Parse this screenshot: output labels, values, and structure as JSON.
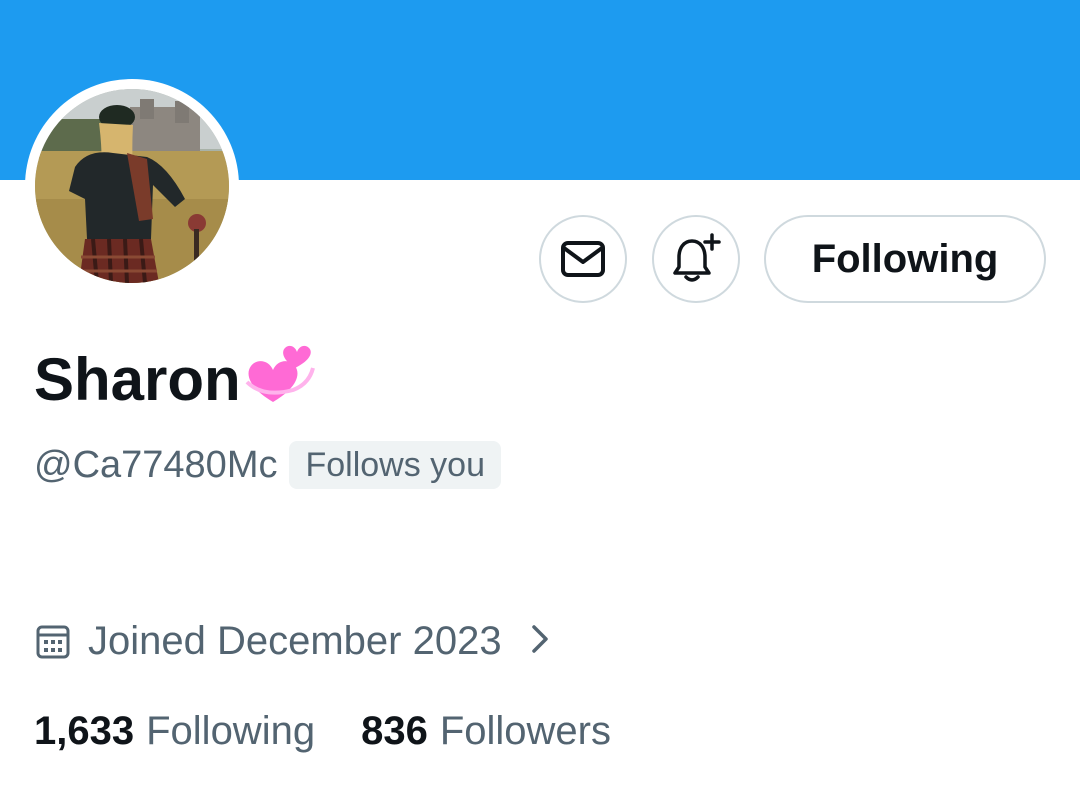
{
  "colors": {
    "banner": "#1d9bf0",
    "text_primary": "#0f1419",
    "text_secondary": "#536471",
    "border": "#cfd9de",
    "badge_bg": "#eff3f4"
  },
  "header": {
    "banner_color": "#1d9bf0"
  },
  "profile": {
    "display_name": "Sharon",
    "name_emoji": "two-hearts-icon",
    "handle": "@Ca77480Mc",
    "follows_you_badge": "Follows you",
    "avatar": "avatar-photo"
  },
  "actions": {
    "message_icon": "envelope-icon",
    "notify_icon": "bell-plus-icon",
    "follow_button_label": "Following"
  },
  "meta": {
    "joined_icon": "calendar-icon",
    "joined_text": "Joined December 2023",
    "joined_chevron": "chevron-right-icon"
  },
  "stats": {
    "following_count": "1,633",
    "following_label": "Following",
    "followers_count": "836",
    "followers_label": "Followers"
  }
}
